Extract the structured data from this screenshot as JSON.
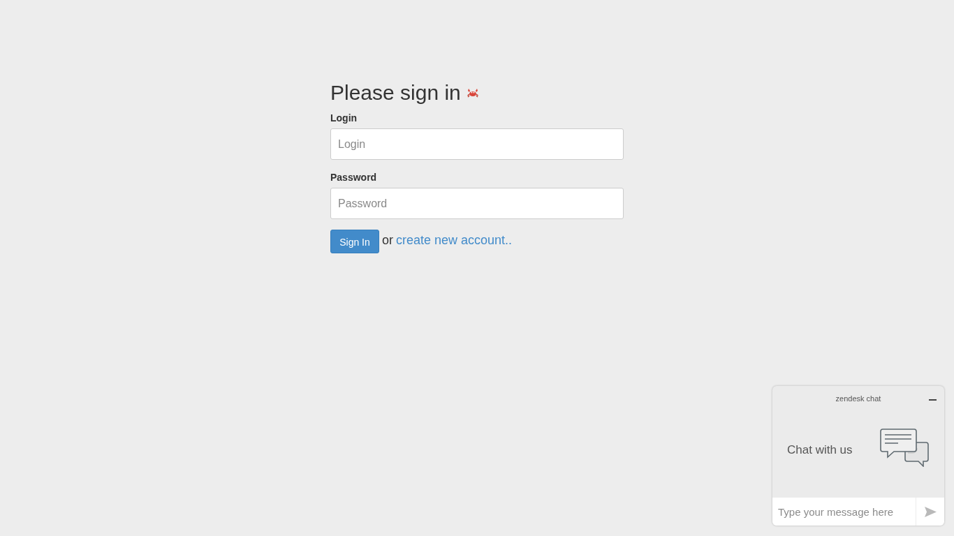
{
  "heading": {
    "title": "Please sign in"
  },
  "form": {
    "fields": [
      {
        "label": "Login",
        "placeholder": "Login"
      },
      {
        "label": "Password",
        "placeholder": "Password"
      }
    ],
    "submit": "Sign In",
    "separator": "or",
    "link": "create new account.."
  },
  "chat_widget": {
    "brand": "zendesk chat",
    "prompt": "Chat with us",
    "input": {
      "placeholder": "Type your message here"
    }
  }
}
